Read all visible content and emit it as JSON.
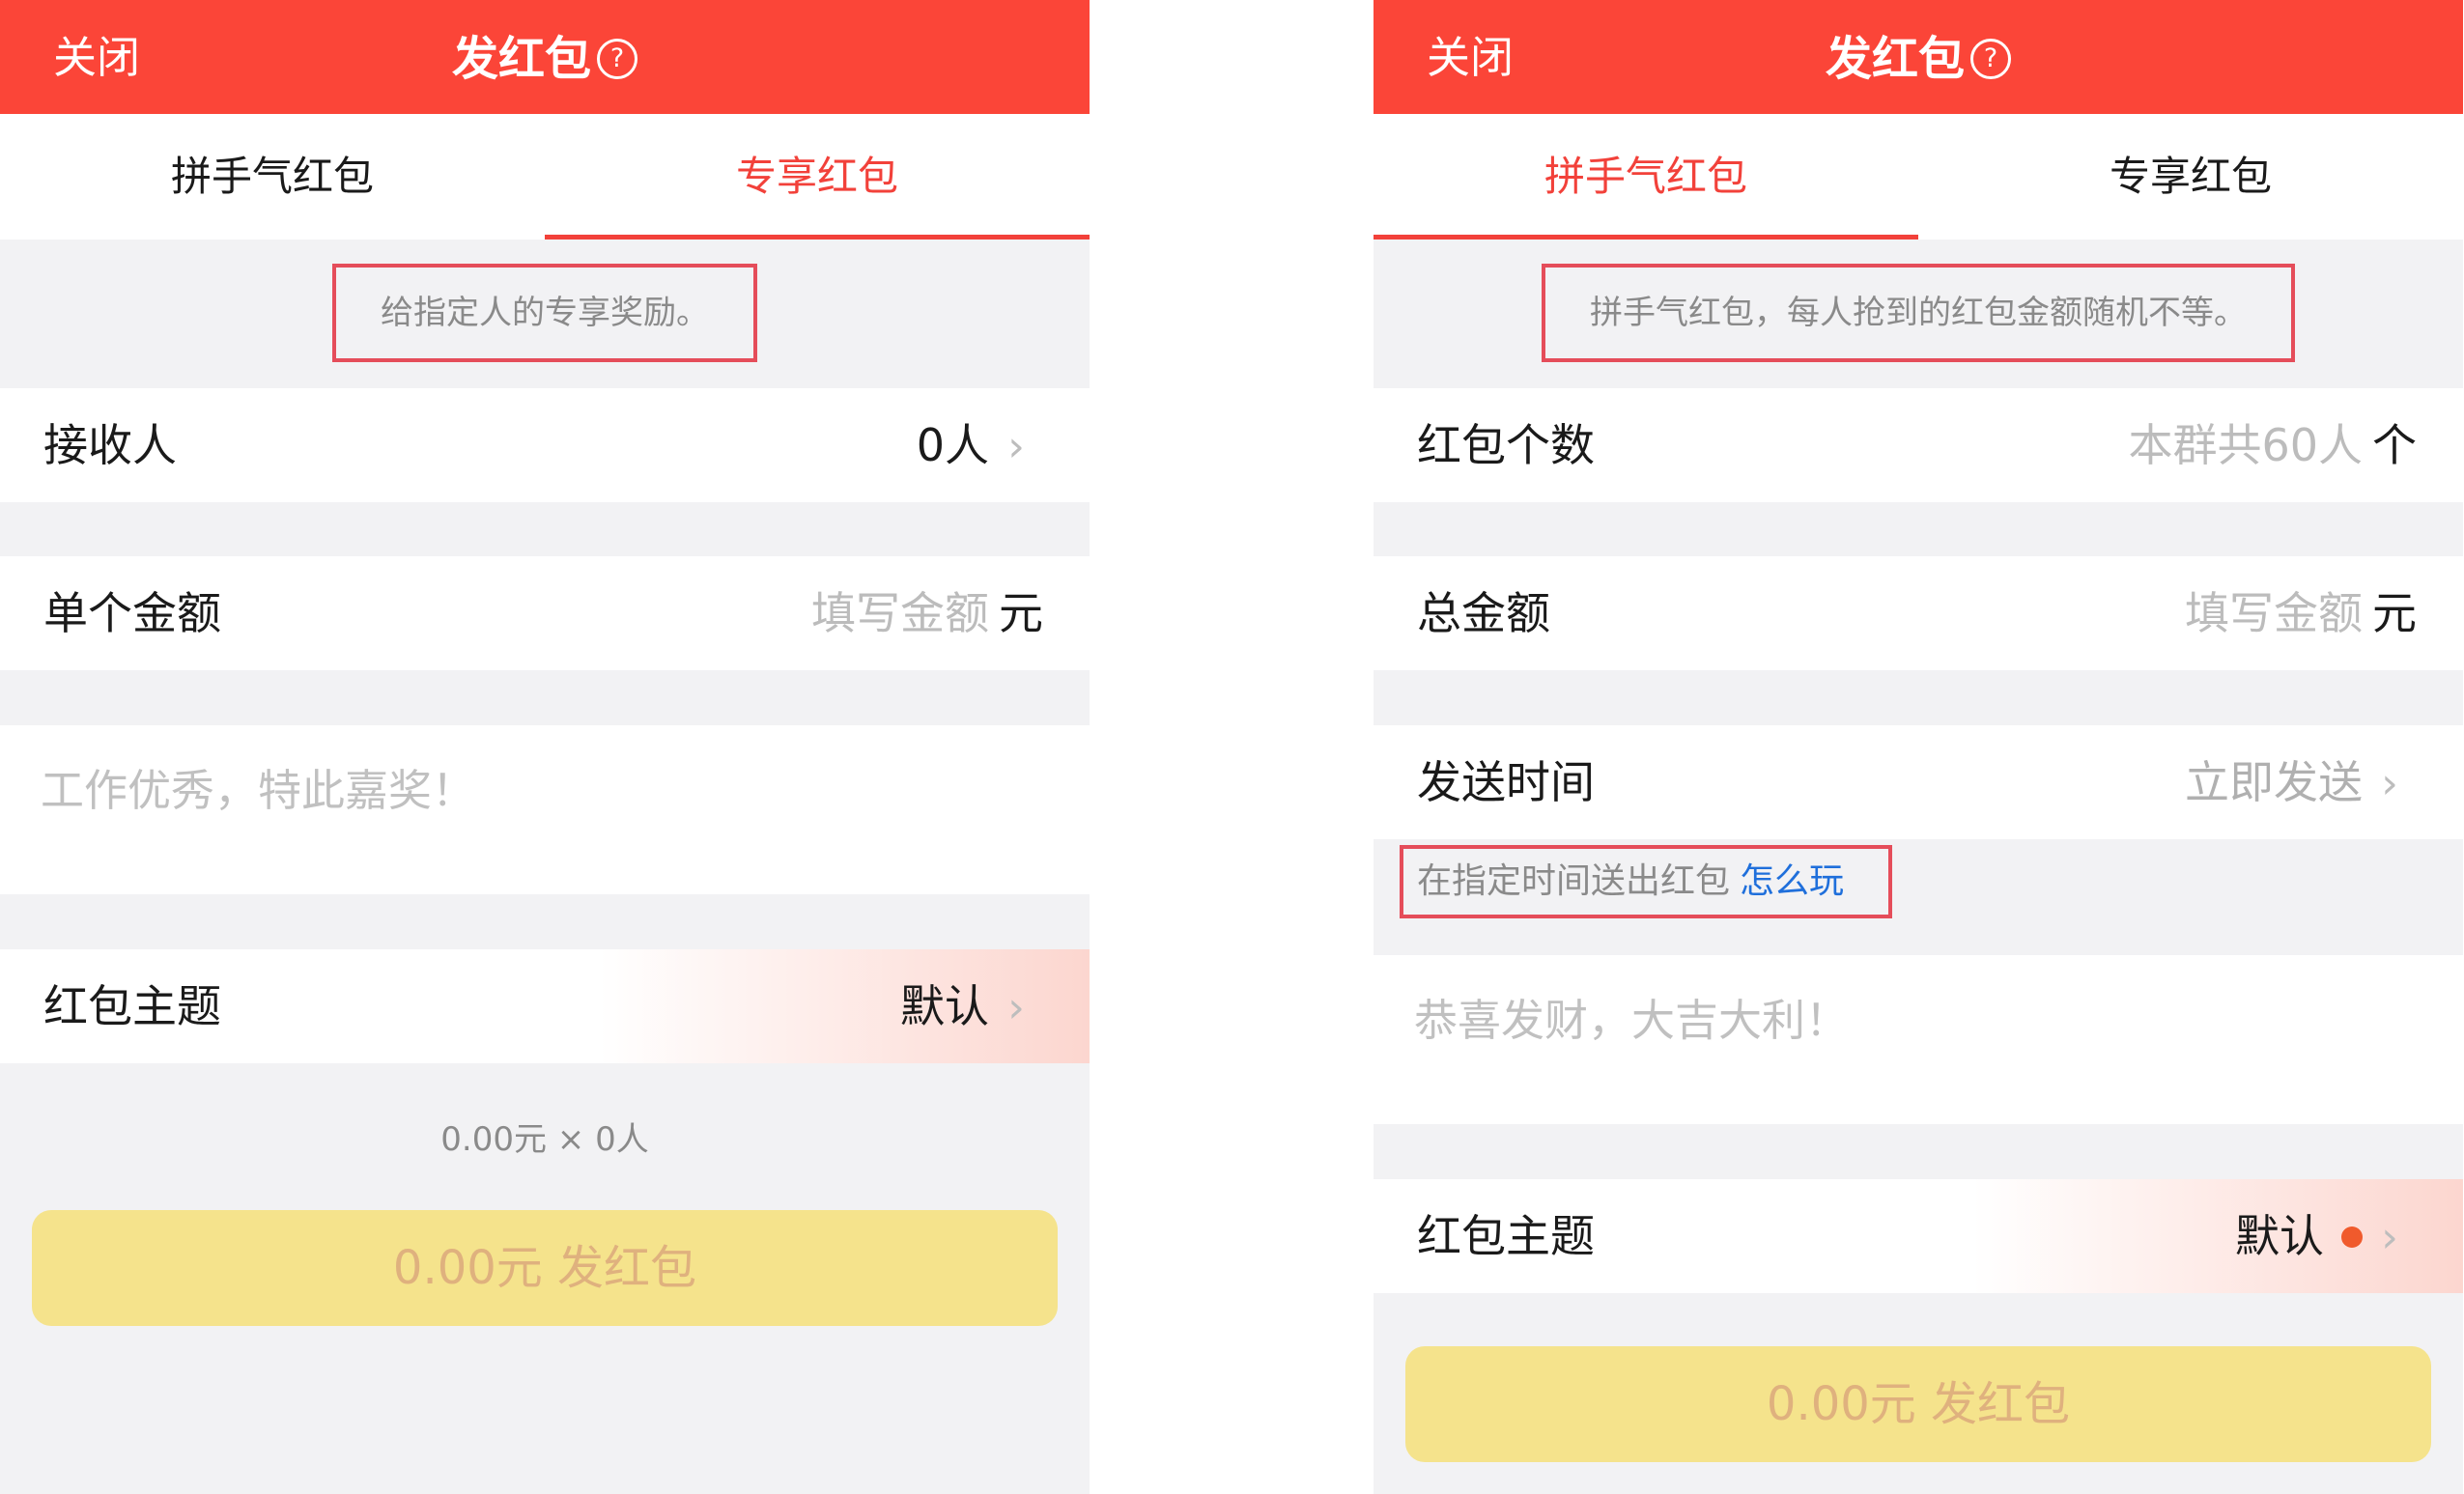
{
  "left": {
    "header": {
      "close": "关闭",
      "title": "发红包",
      "help": "?"
    },
    "tabs": [
      {
        "label": "拼手气红包"
      },
      {
        "label": "专享红包"
      }
    ],
    "note": "给指定人的专享奖励。",
    "recipient": {
      "label": "接收人",
      "value": "0人"
    },
    "amount": {
      "label": "单个金额",
      "placeholder": "填写金额",
      "unit": "元"
    },
    "message": {
      "placeholder": "工作优秀，特此嘉奖！"
    },
    "theme": {
      "label": "红包主题",
      "value": "默认"
    },
    "summary": "0.00元 × 0人",
    "send_button": "0.00元 发红包"
  },
  "right": {
    "header": {
      "close": "关闭",
      "title": "发红包",
      "help": "?"
    },
    "tabs": [
      {
        "label": "拼手气红包"
      },
      {
        "label": "专享红包"
      }
    ],
    "note": "拼手气红包，每人抢到的红包金额随机不等。",
    "count": {
      "label": "红包个数",
      "placeholder": "本群共60人",
      "unit": "个"
    },
    "total": {
      "label": "总金额",
      "placeholder": "填写金额",
      "unit": "元"
    },
    "send_time": {
      "label": "发送时间",
      "value": "立即发送"
    },
    "hint": {
      "text": "在指定时间送出红包",
      "link": "怎么玩"
    },
    "message": {
      "placeholder": "恭喜发财，大吉大利！"
    },
    "theme": {
      "label": "红包主题",
      "value": "默认"
    },
    "send_button": "0.00元 发红包"
  },
  "colors": {
    "header": "#fb4538",
    "accent": "#f2413a",
    "button": "#f5e38c",
    "button_text": "#dfb17e",
    "link": "#1f6fdb",
    "highlight_box": "#e54d5a"
  }
}
